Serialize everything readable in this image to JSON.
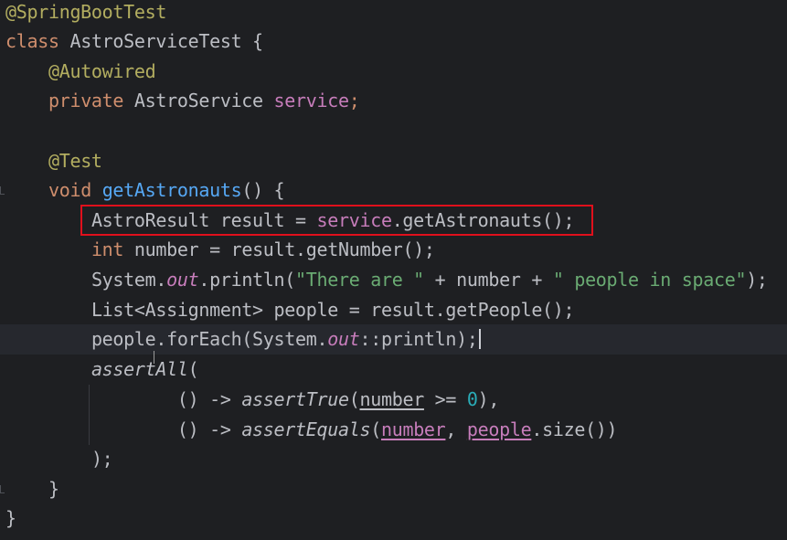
{
  "editor": {
    "language": "Java",
    "theme_colors": {
      "background": "#1e1f22",
      "text": "#bcbec4",
      "keyword": "#cf8e6d",
      "annotation": "#b3ae60",
      "method_declaration": "#56a8f5",
      "field": "#c77dbb",
      "string": "#6aab73",
      "number": "#2aacb8",
      "highlight_box": "#e0101c"
    },
    "highlighted_line": "AstroResult result = service.getAstronauts();",
    "lines": {
      "l1": {
        "ann": "@SpringBootTest"
      },
      "l2": {
        "kw": "class",
        "rest": " AstroServiceTest {"
      },
      "l3": {
        "ann": "@Autowired"
      },
      "l4": {
        "kw": "private",
        "type": " AstroService ",
        "field": "service",
        "end": ";"
      },
      "l6": {
        "ann": "@Test"
      },
      "l7": {
        "kw": "void",
        "space": " ",
        "method": "getAstronauts",
        "rest": "() {"
      },
      "l8": {
        "a": "AstroResult result = ",
        "field": "service",
        "b": ".getAstronauts();"
      },
      "l9": {
        "kw": "int",
        "rest": " number = result.getNumber();"
      },
      "l10": {
        "a": "System.",
        "static": "out",
        "b": ".println(",
        "str1": "\"There are \"",
        "c": " + number + ",
        "str2": "\" people in space\"",
        "d": ");"
      },
      "l11": {
        "a": "List<Assignment> people = result.getPeople();"
      },
      "l12": {
        "a": "people.forEach(System.",
        "static": "out",
        "b": "::println);"
      },
      "l13": {
        "ital": "assertAll",
        "rest": "("
      },
      "l14": {
        "a": "() -> ",
        "ital": "assertTrue",
        "b": "(",
        "und": "number",
        "c": " >= ",
        "num": "0",
        "d": "),"
      },
      "l15": {
        "a": "() -> ",
        "ital": "assertEquals",
        "b": "(",
        "und1": "number",
        "c": ", ",
        "und2": "people",
        "d": ".size())"
      },
      "l16": {
        "a": ");"
      },
      "l17": {
        "a": "}"
      },
      "l18": {
        "a": "}"
      }
    }
  }
}
